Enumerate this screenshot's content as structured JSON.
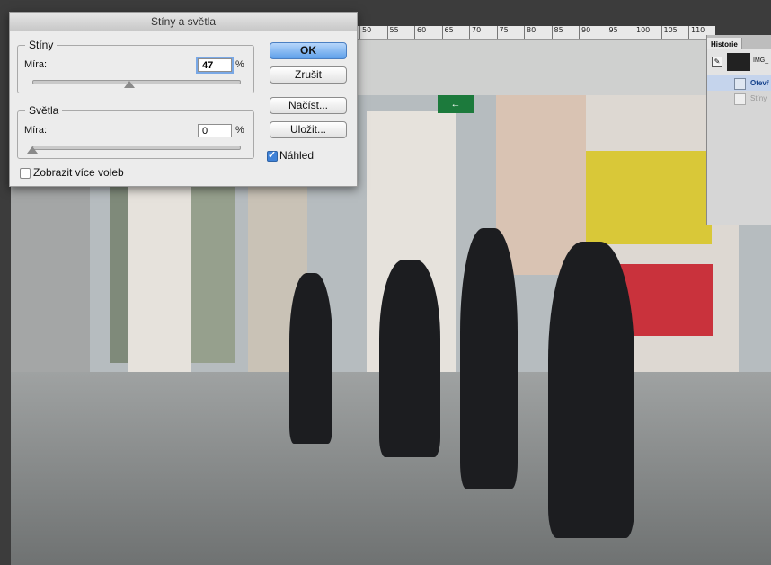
{
  "dialog": {
    "title": "Stíny a světla",
    "shadows": {
      "group_label": "Stíny",
      "amount_label": "Míra:",
      "amount_value": "47",
      "unit": "%",
      "slider_fraction": 0.47
    },
    "highlights": {
      "group_label": "Světla",
      "amount_label": "Míra:",
      "amount_value": "0",
      "unit": "%",
      "slider_fraction": 0.0
    },
    "buttons": {
      "ok": "OK",
      "cancel": "Zrušit",
      "load": "Načíst...",
      "save": "Uložit..."
    },
    "preview_label": "Náhled",
    "preview_checked": true,
    "more_options_label": "Zobrazit více voleb",
    "more_options_checked": false
  },
  "ruler": {
    "ticks": [
      "50",
      "55",
      "60",
      "65",
      "70",
      "75",
      "80",
      "85",
      "90",
      "95",
      "100",
      "105",
      "110"
    ]
  },
  "history": {
    "tab_label": "Historie",
    "snapshot_name": "IMG_",
    "rows": [
      {
        "label": "Otevř",
        "state": "active"
      },
      {
        "label": "Stíny",
        "state": "dim"
      }
    ]
  },
  "colors": {
    "ok_accent": "#5fa0ea",
    "dialog_bg": "#ececec"
  }
}
